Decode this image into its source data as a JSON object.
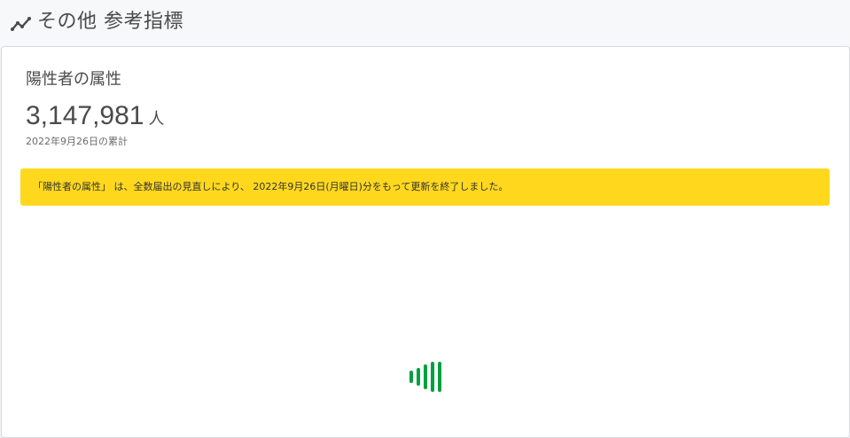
{
  "header": {
    "title": "その他 参考指標",
    "icon": "trend-line-icon"
  },
  "card": {
    "title": "陽性者の属性",
    "value": "3,147,981",
    "unit": "人",
    "date_note": "2022年9月26日の累計"
  },
  "notice": {
    "text": "「陽性者の属性」 は、全数届出の見直しにより、 2022年9月26日(月曜日)分をもって更新を終了しました。",
    "color": "#ffd81d"
  },
  "loader": {
    "icon": "loading-bars-icon",
    "color": "#00a040"
  }
}
